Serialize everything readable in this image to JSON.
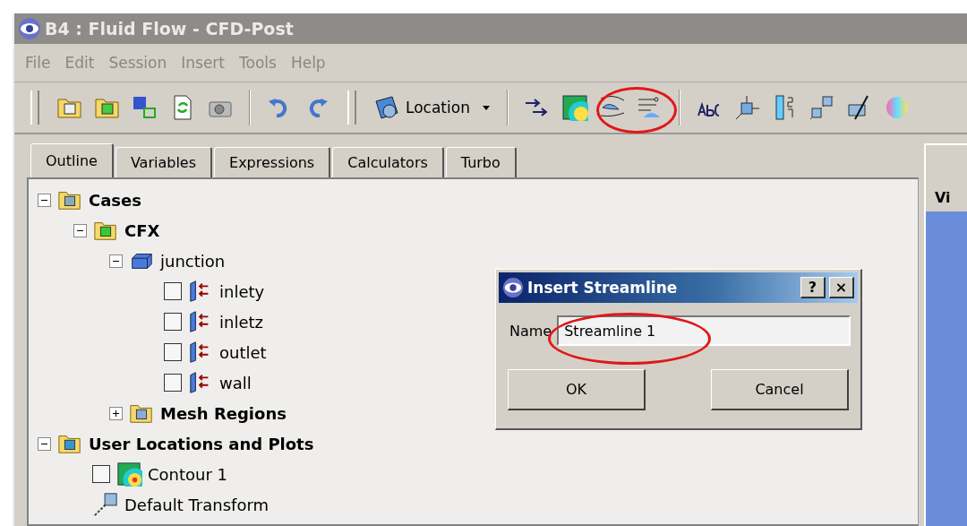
{
  "window": {
    "title": "B4 : Fluid Flow - CFD-Post"
  },
  "menu": [
    "File",
    "Edit",
    "Session",
    "Insert",
    "Tools",
    "Help"
  ],
  "toolbar": {
    "location_label": "Location"
  },
  "tabs": [
    {
      "label": "Outline",
      "selected": true
    },
    {
      "label": "Variables",
      "selected": false
    },
    {
      "label": "Expressions",
      "selected": false
    },
    {
      "label": "Calculators",
      "selected": false
    },
    {
      "label": "Turbo",
      "selected": false
    }
  ],
  "tree": [
    {
      "label": "Cases",
      "kind": "folder",
      "bold": true,
      "expanded": true,
      "children": [
        {
          "label": "CFX",
          "kind": "cfx",
          "bold": true,
          "expanded": true,
          "children": [
            {
              "label": "junction",
              "kind": "domain",
              "bold": false,
              "expanded": true,
              "children": [
                {
                  "label": "inlety",
                  "kind": "boundary",
                  "bold": false,
                  "checked": false
                },
                {
                  "label": "inletz",
                  "kind": "boundary",
                  "bold": false,
                  "checked": false
                },
                {
                  "label": "outlet",
                  "kind": "boundary",
                  "bold": false,
                  "checked": false
                },
                {
                  "label": "wall",
                  "kind": "boundary",
                  "bold": false,
                  "checked": false
                }
              ]
            },
            {
              "label": "Mesh Regions",
              "kind": "mesh",
              "bold": true,
              "expanded": false
            }
          ]
        }
      ]
    },
    {
      "label": "User Locations and Plots",
      "kind": "user",
      "bold": true,
      "expanded": true,
      "children": [
        {
          "label": "Contour 1",
          "kind": "contour",
          "bold": false,
          "checked": false
        },
        {
          "label": "Default Transform",
          "kind": "transform",
          "bold": false
        }
      ]
    }
  ],
  "viewer": {
    "title": "Vi"
  },
  "dialog": {
    "title": "Insert Streamline",
    "help": "?",
    "close": "×",
    "name_label": "Name",
    "name_value": "Streamline 1",
    "buttons": [
      "OK",
      "Cancel"
    ]
  }
}
